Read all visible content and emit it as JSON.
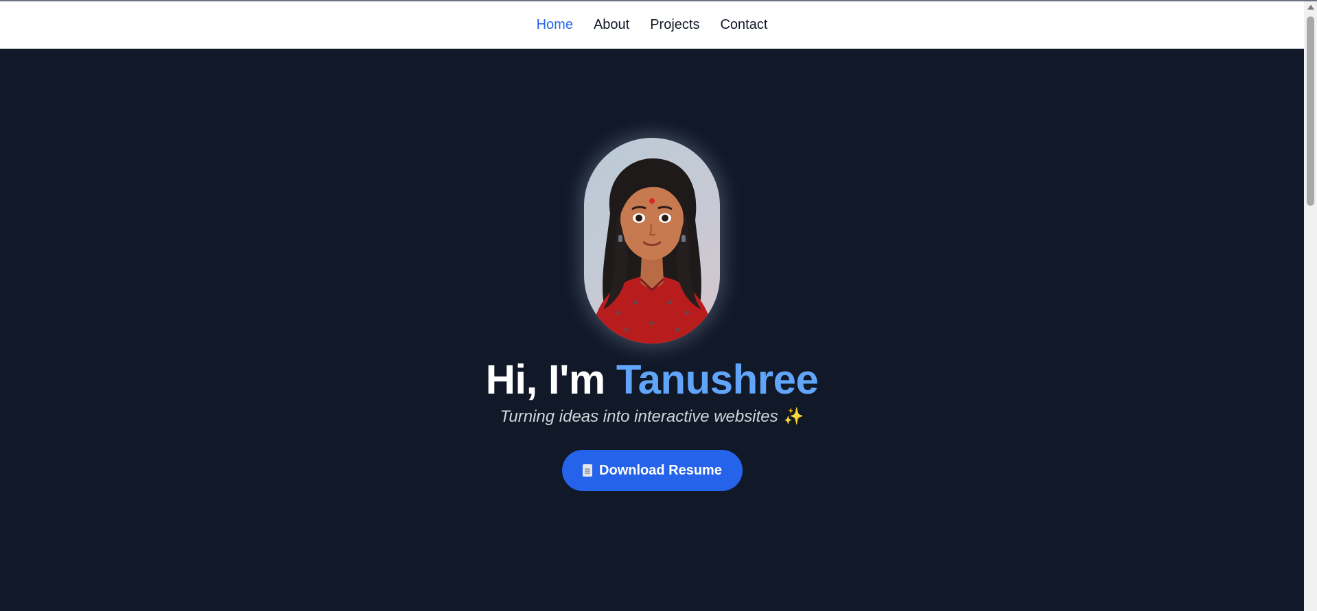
{
  "nav": {
    "items": [
      {
        "label": "Home",
        "active": true
      },
      {
        "label": "About",
        "active": false
      },
      {
        "label": "Projects",
        "active": false
      },
      {
        "label": "Contact",
        "active": false
      }
    ]
  },
  "hero": {
    "greeting": "Hi, I'm",
    "name": "Tanushree",
    "tagline": "Turning ideas into interactive websites",
    "tagline_emoji": "✨",
    "resume_button_label": "Download Resume",
    "resume_button_icon": "document-icon",
    "avatar": "avatar-illustration"
  },
  "colors": {
    "background": "#111827",
    "accent": "#2563eb",
    "name_highlight": "#60a5fa",
    "nav_background": "#ffffff"
  }
}
